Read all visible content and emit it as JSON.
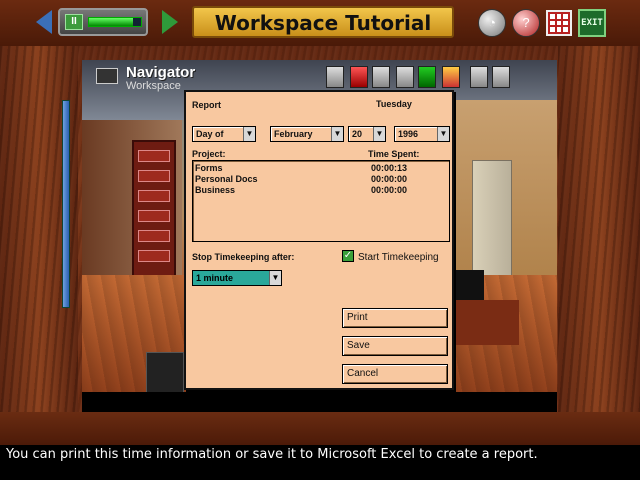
{
  "app": {
    "title": "Workspace Tutorial",
    "progress": 0.85
  },
  "toolbar": {
    "pause_label": "II",
    "exit_label": "EXIT"
  },
  "navigator": {
    "title": "Navigator",
    "subtitle": "Workspace"
  },
  "dialog": {
    "report_label": "Report",
    "day_label": "Tuesday",
    "range_select": "Day of",
    "month_select": "February",
    "day_select": "20",
    "year_select": "1996",
    "project_header": "Project:",
    "time_header": "Time Spent:",
    "projects": [
      {
        "name": "Forms",
        "time": "00:00:13"
      },
      {
        "name": "Personal Docs",
        "time": "00:00:00"
      },
      {
        "name": "Business",
        "time": "00:00:00"
      }
    ],
    "stop_label": "Stop Timekeeping after:",
    "start_label": "Start Timekeeping",
    "start_checked": true,
    "stop_select": "1 minute",
    "print_button": "Print",
    "save_button": "Save",
    "cancel_button": "Cancel"
  },
  "caption": "You can print this time information or save it to Microsoft Excel to create a report."
}
